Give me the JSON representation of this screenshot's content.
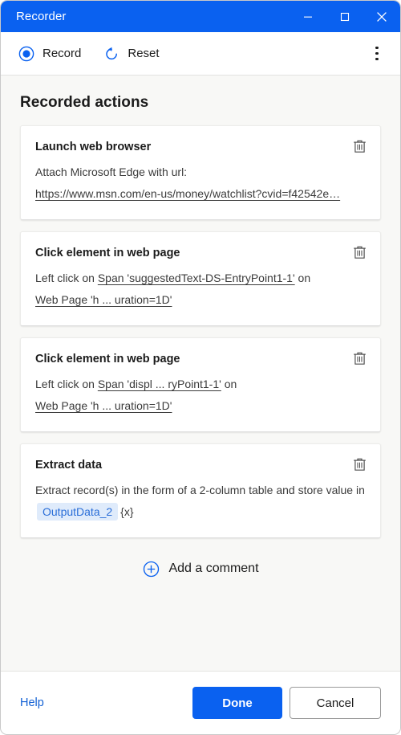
{
  "titlebar": {
    "title": "Recorder",
    "minimize_label": "Minimize",
    "maximize_label": "Maximize",
    "close_label": "Close"
  },
  "toolbar": {
    "record_label": "Record",
    "reset_label": "Reset",
    "more_label": "More options"
  },
  "main": {
    "section_title": "Recorded actions",
    "add_comment_label": "Add a comment",
    "actions": [
      {
        "title": "Launch web browser",
        "line1": "Attach Microsoft Edge with url:",
        "line2": "https://www.msn.com/en-us/money/watchlist?cvid=f42542e…",
        "delete_label": "Delete action"
      },
      {
        "title": "Click element in web page",
        "prefix": "Left click on",
        "target": "Span 'suggestedText-DS-EntryPoint1-1'",
        "joiner": "on",
        "page": "Web Page 'h ... uration=1D'",
        "delete_label": "Delete action"
      },
      {
        "title": "Click element in web page",
        "prefix": "Left click on",
        "target": "Span 'displ ... ryPoint1-1'",
        "joiner": "on",
        "page": "Web Page 'h ... uration=1D'",
        "delete_label": "Delete action"
      },
      {
        "title": "Extract data",
        "text": "Extract record(s) in the form of a 2-column table and store value in",
        "variable": "OutputData_2",
        "variable_suffix": "{x}",
        "delete_label": "Delete action"
      }
    ]
  },
  "footer": {
    "help_label": "Help",
    "done_label": "Done",
    "cancel_label": "Cancel"
  },
  "colors": {
    "accent": "#0a61f0",
    "title_bar": "#0a61f0",
    "body_background": "#f8f8f6",
    "card_background": "#ffffff",
    "chip_background": "#dfebfb",
    "chip_text": "#2a6ed8",
    "link": "#1160d4"
  }
}
